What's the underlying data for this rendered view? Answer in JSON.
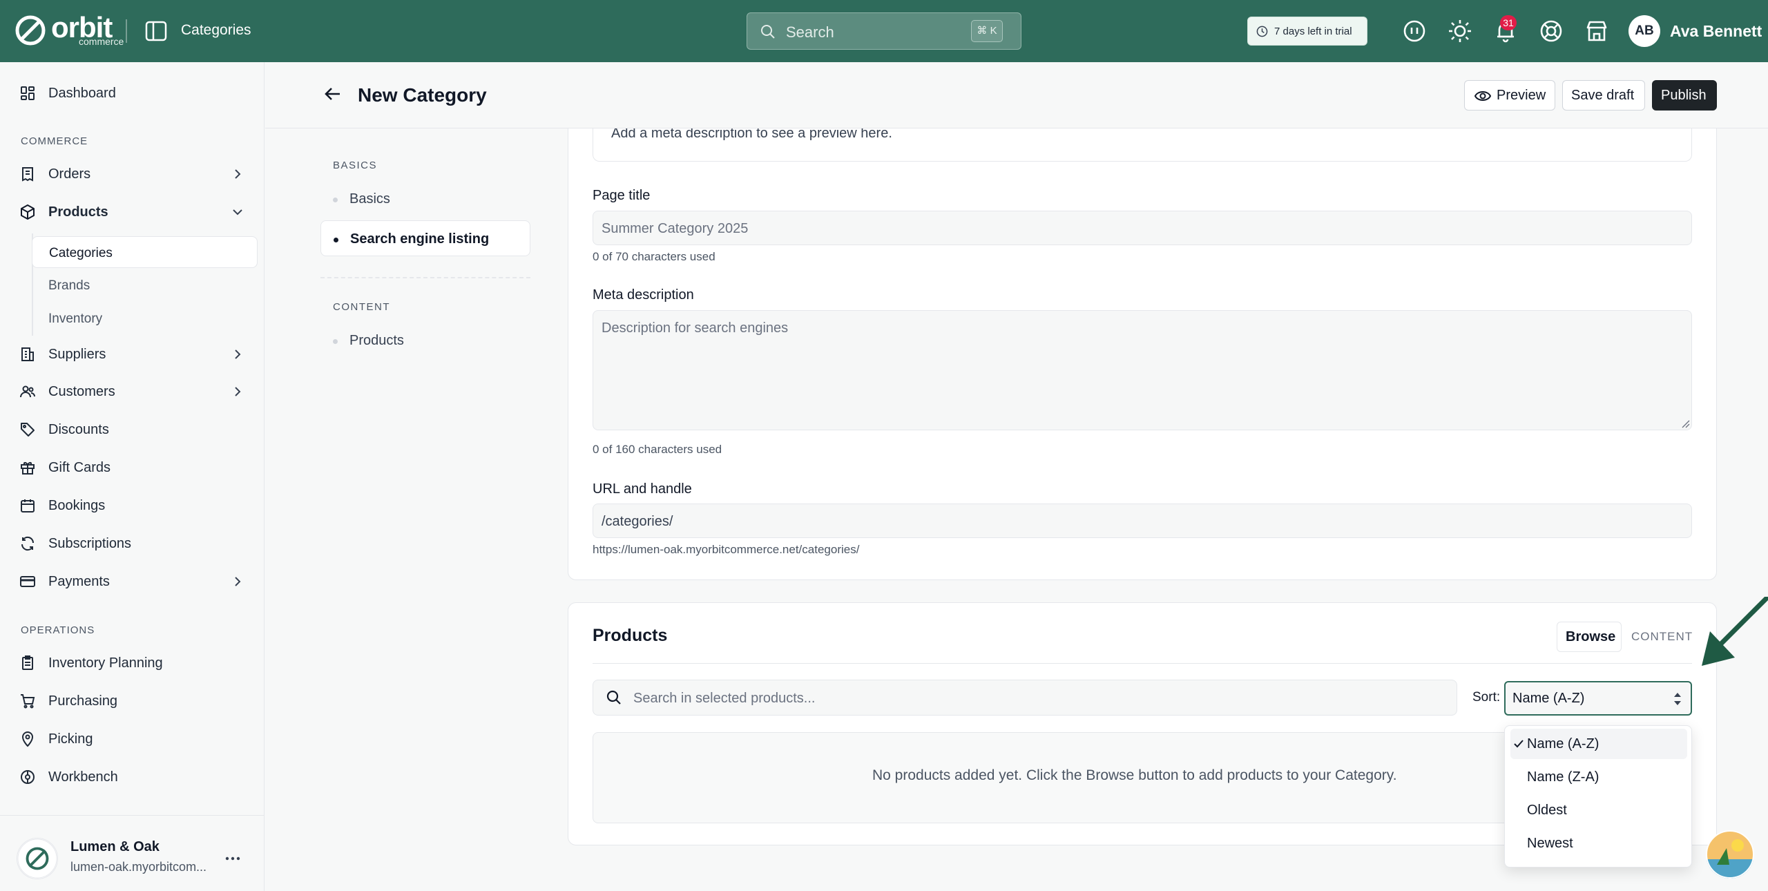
{
  "brand": {
    "name": "orbit",
    "sub": "commerce"
  },
  "topbar": {
    "section": "Categories",
    "search_placeholder": "Search",
    "search_shortcut": "⌘ K",
    "trial": "7 days left in trial",
    "notifications_count": "31",
    "user_initials": "AB",
    "user_name": "Ava Bennett"
  },
  "sidebar": {
    "dashboard": "Dashboard",
    "commerce_label": "COMMERCE",
    "orders": "Orders",
    "products": "Products",
    "sub": {
      "categories": "Categories",
      "brands": "Brands",
      "inventory": "Inventory"
    },
    "suppliers": "Suppliers",
    "customers": "Customers",
    "discounts": "Discounts",
    "gift_cards": "Gift Cards",
    "bookings": "Bookings",
    "subscriptions": "Subscriptions",
    "payments": "Payments",
    "operations_label": "OPERATIONS",
    "inventory_planning": "Inventory Planning",
    "purchasing": "Purchasing",
    "picking": "Picking",
    "workbench": "Workbench",
    "store_name": "Lumen & Oak",
    "store_url": "lumen-oak.myorbitcom..."
  },
  "header": {
    "title": "New Category",
    "preview": "Preview",
    "save_draft": "Save draft",
    "publish": "Publish"
  },
  "section_nav": {
    "basics_label": "BASICS",
    "basics": "Basics",
    "seo": "Search engine listing",
    "content_label": "CONTENT",
    "products": "Products"
  },
  "seo": {
    "preview_text": "Add a meta description to see a preview here.",
    "page_title_label": "Page title",
    "page_title_placeholder": "Summer Category 2025",
    "page_title_hint": "0 of 70 characters used",
    "meta_label": "Meta description",
    "meta_placeholder": "Description for search engines",
    "meta_hint": "0 of 160 characters used",
    "url_label": "URL and handle",
    "url_value": "/categories/",
    "url_full": "https://lumen-oak.myorbitcommerce.net/categories/"
  },
  "products": {
    "title": "Products",
    "browse": "Browse",
    "content_tag": "CONTENT",
    "search_placeholder": "Search in selected products...",
    "sort_label": "Sort:",
    "sort_value": "Name (A-Z)",
    "empty": "No products added yet. Click the Browse button to add products to your Category.",
    "sort_options": [
      "Name (A-Z)",
      "Name (Z-A)",
      "Oldest",
      "Newest"
    ]
  },
  "colors": {
    "topbar": "#2e6b5b",
    "primary_button": "#1f2428",
    "badge": "#e11d48"
  }
}
